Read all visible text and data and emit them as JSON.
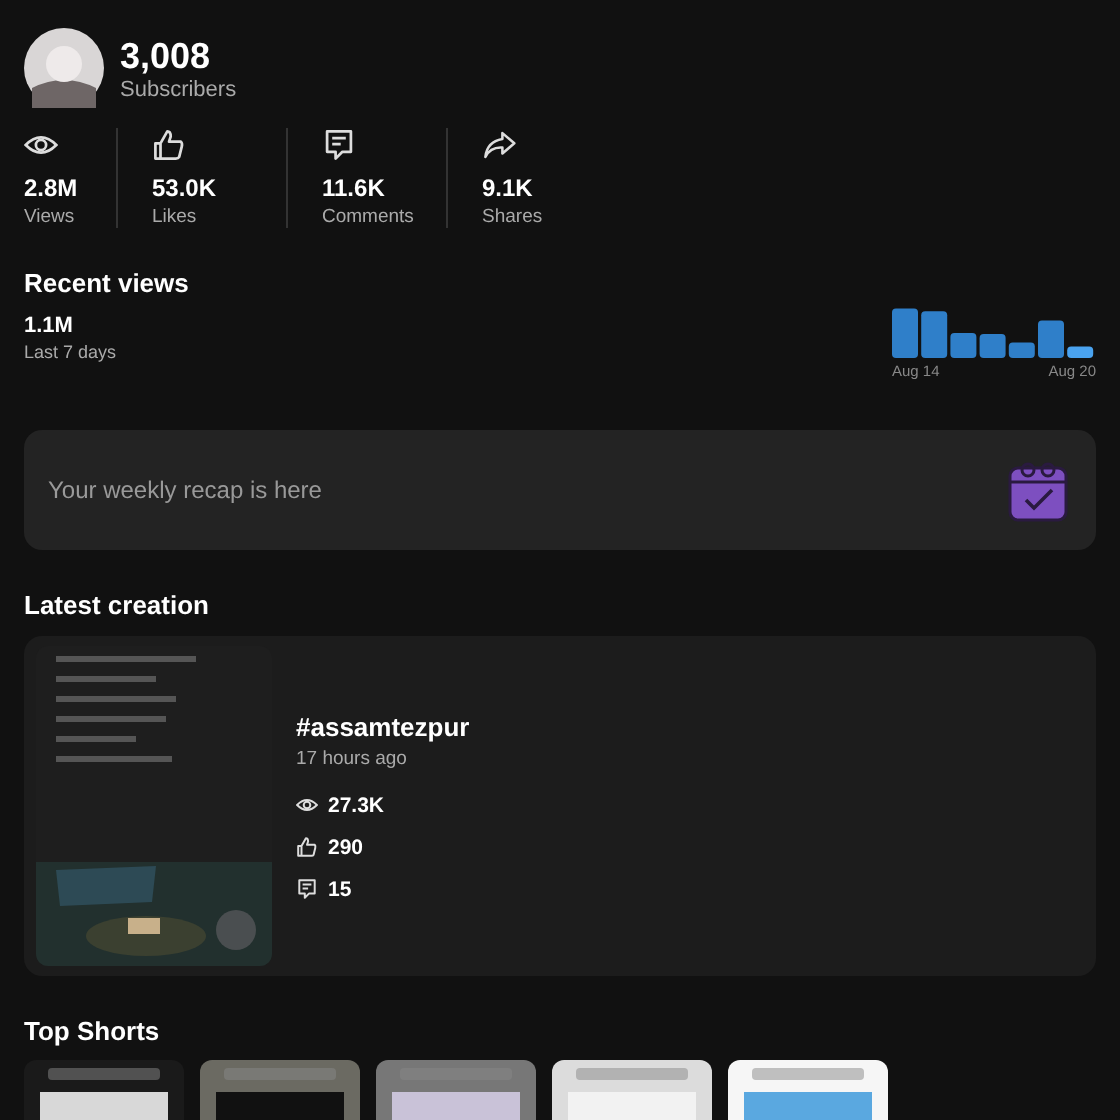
{
  "profile": {
    "subscribers": "3,008",
    "subscribers_label": "Subscribers"
  },
  "stats": [
    {
      "kind": "views",
      "value": "2.8M",
      "label": "Views"
    },
    {
      "kind": "likes",
      "value": "53.0K",
      "label": "Likes"
    },
    {
      "kind": "comments",
      "value": "11.6K",
      "label": "Comments"
    },
    {
      "kind": "shares",
      "value": "9.1K",
      "label": "Shares"
    }
  ],
  "recent_views": {
    "title": "Recent views",
    "total": "1.1M",
    "period": "Last 7 days",
    "start_label": "Aug 14",
    "end_label": "Aug 20"
  },
  "recap": {
    "text": "Your weekly recap is here"
  },
  "latest_creation": {
    "title": "Latest creation",
    "video_title": "#assamtezpur",
    "posted": "17 hours ago",
    "metrics": [
      {
        "kind": "views",
        "value": "27.3K"
      },
      {
        "kind": "likes",
        "value": "290"
      },
      {
        "kind": "comments",
        "value": "15"
      }
    ]
  },
  "top_shorts": {
    "title": "Top Shorts"
  }
}
